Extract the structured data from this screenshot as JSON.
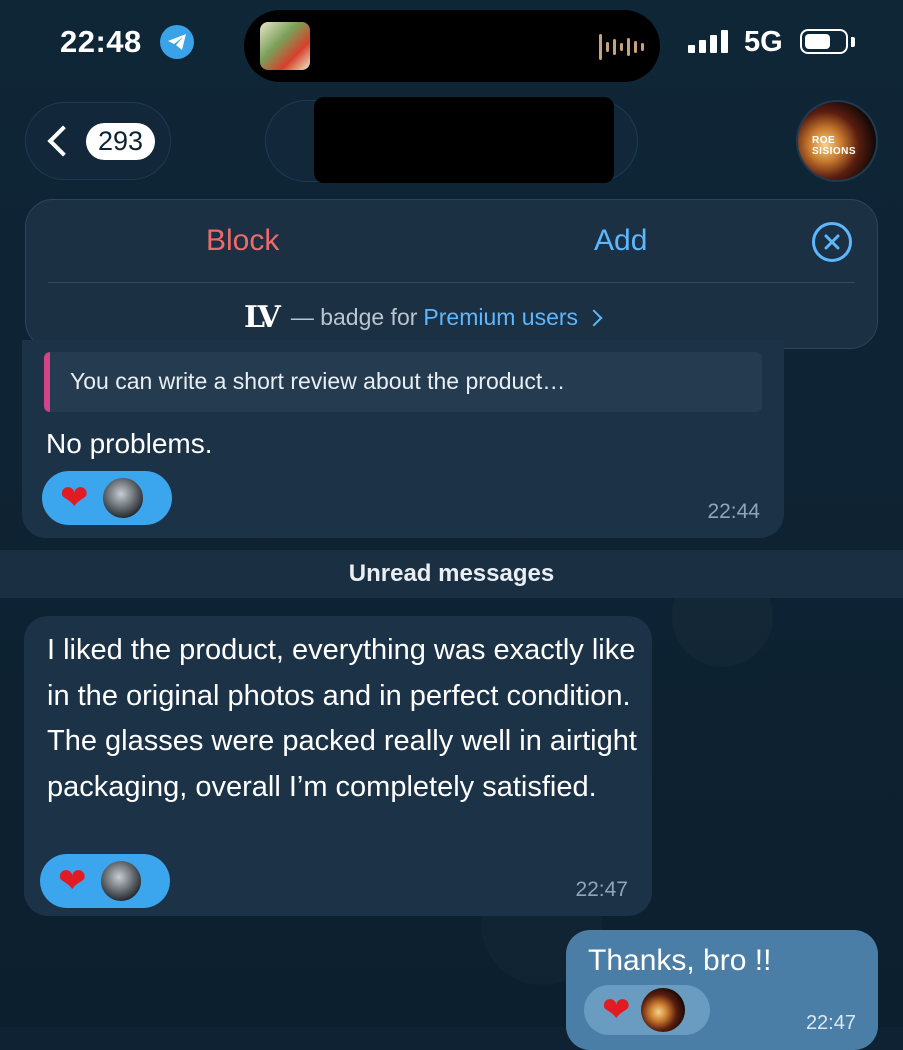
{
  "status_bar": {
    "time": "22:48",
    "network": "5G",
    "battery_level": 0.55
  },
  "header": {
    "back_count": "293",
    "avatar_text": "ROE SISIONS"
  },
  "action_panel": {
    "block_label": "Block",
    "add_label": "Add",
    "badge_logo": "LV",
    "badge_text": "— badge for",
    "premium_link": "Premium users"
  },
  "messages": [
    {
      "quote": "You can write a short review about the product…",
      "text": "No problems.",
      "time": "22:44",
      "reactions": [
        "heart",
        "avatar"
      ]
    },
    {
      "text": "I liked the product, everything was exactly like in the original photos and in perfect condition. The glasses were packed really well in airtight packaging, overall I’m completely satisfied.",
      "time": "22:47",
      "reactions": [
        "heart",
        "avatar"
      ]
    },
    {
      "text": "Thanks, bro !!",
      "time": "22:47",
      "outgoing": true,
      "reactions": [
        "heart",
        "avatar"
      ]
    }
  ],
  "unread_label": "Unread messages",
  "colors": {
    "background": "#0e2233",
    "incoming_bubble": "#1c3347",
    "outgoing_bubble": "#4a7ea6",
    "block_red": "#ee6a6a",
    "link_blue": "#5db7ff",
    "reaction_blue": "#3ba5ee"
  }
}
